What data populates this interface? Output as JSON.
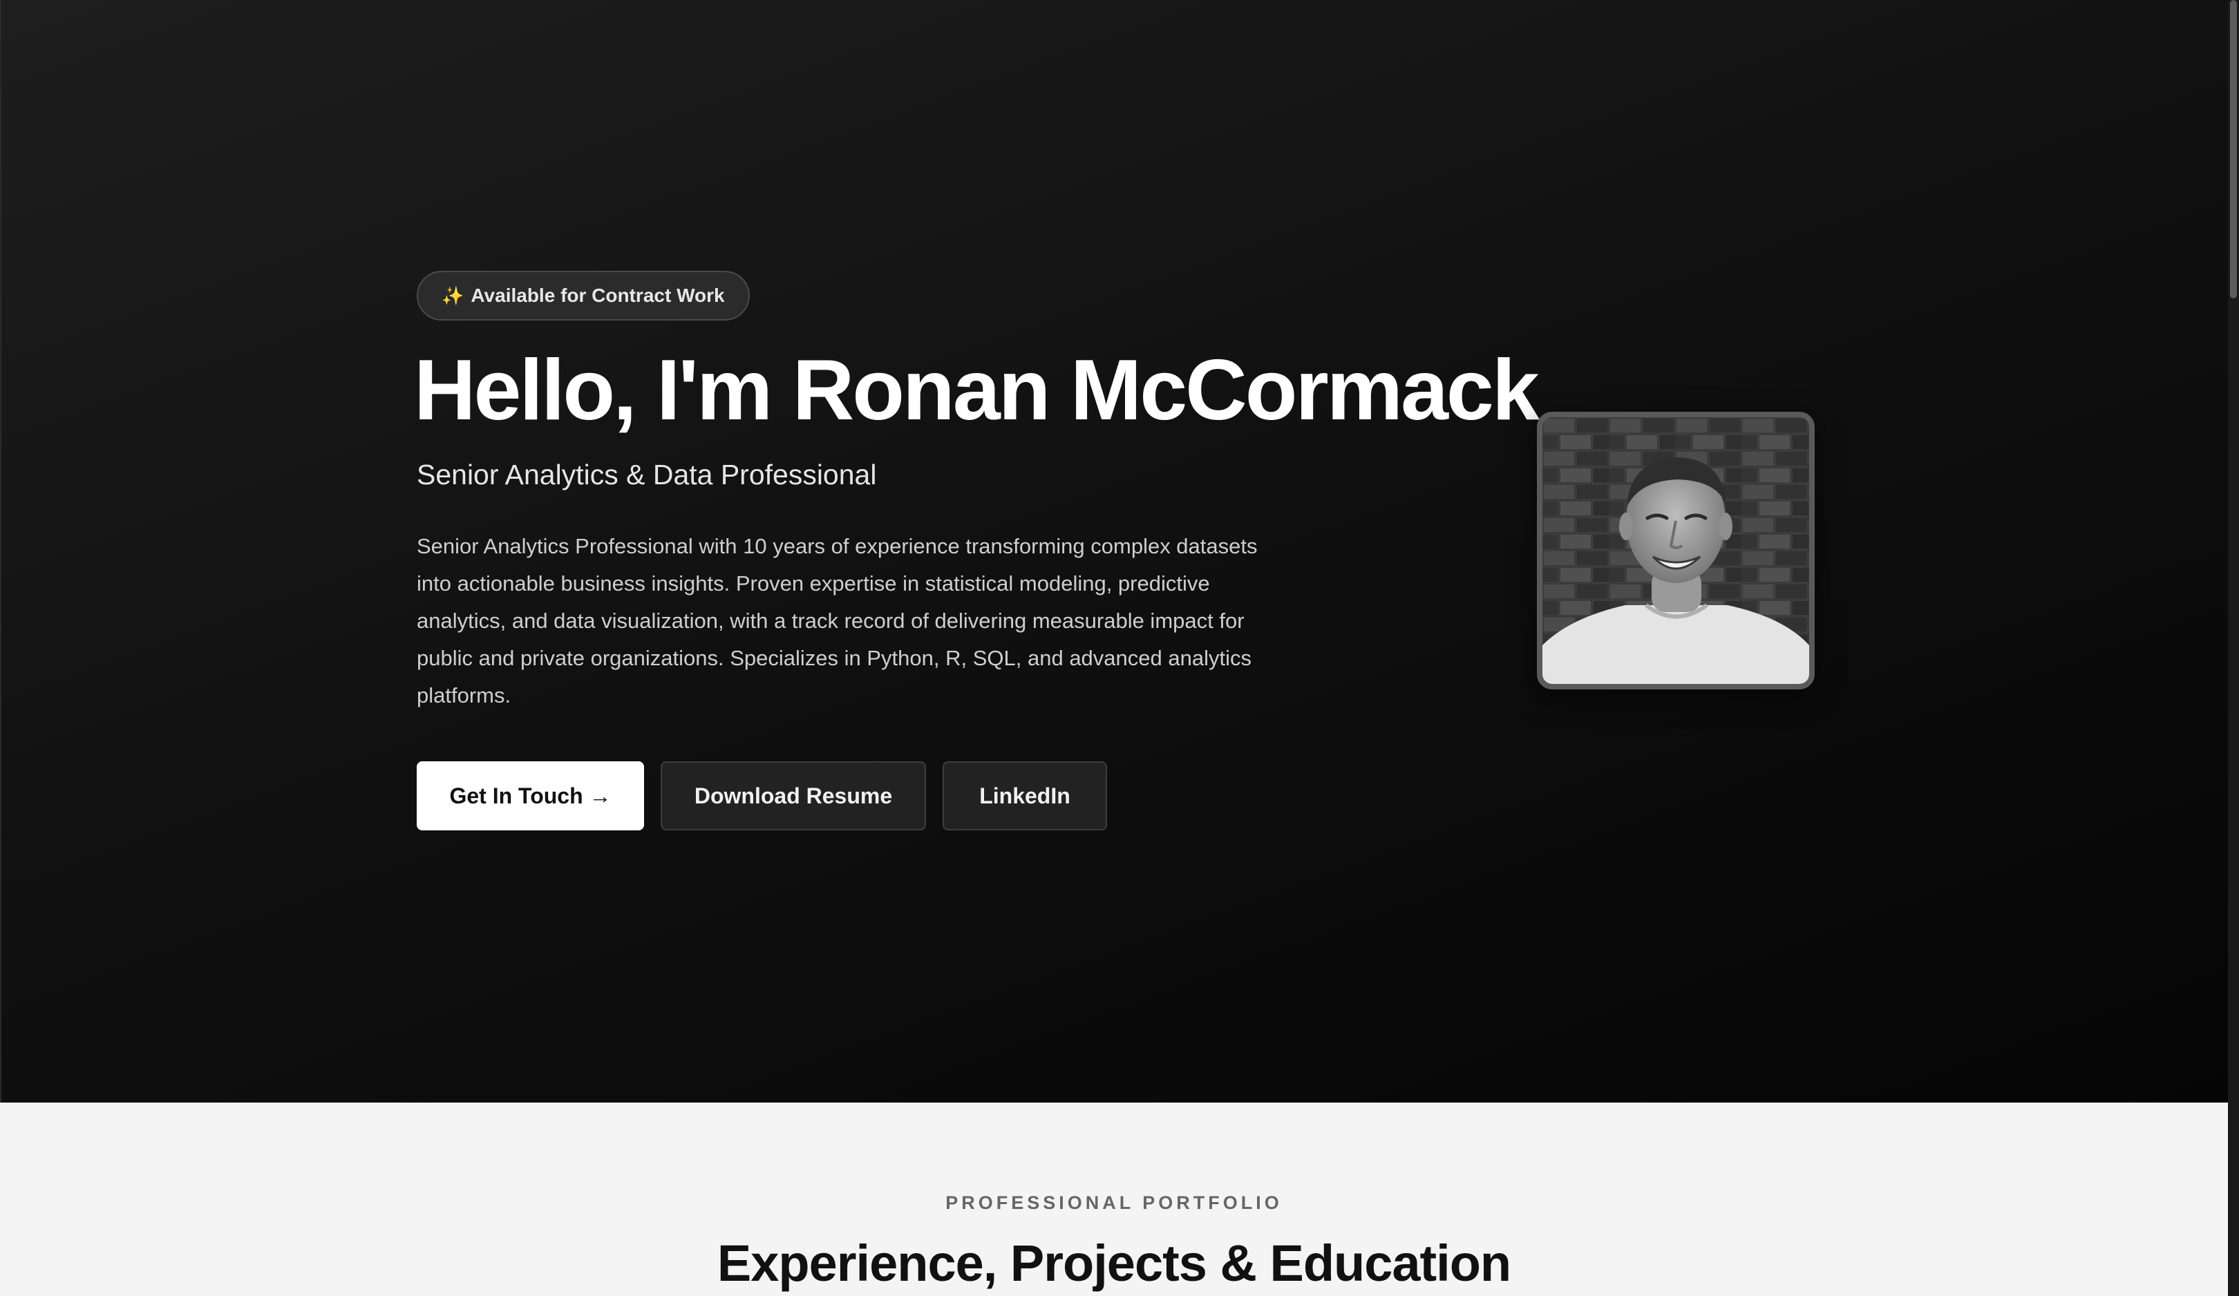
{
  "hero": {
    "badge": {
      "icon": "sparkle-icon",
      "icon_glyph": "✨",
      "label": "Available for Contract Work"
    },
    "title": "Hello, I'm Ronan McCormack",
    "subtitle": "Senior Analytics & Data Professional",
    "description": "Senior Analytics Professional with 10 years of experience transforming complex datasets into actionable business insights. Proven expertise in statistical modeling, predictive analytics, and data visualization, with a track record of delivering measurable impact for public and private organizations. Specializes in Python, R, SQL, and advanced analytics platforms.",
    "buttons": {
      "get_in_touch": "Get In Touch →",
      "download_resume": "Download Resume",
      "linkedin": "LinkedIn"
    }
  },
  "portfolio": {
    "eyebrow": "PROFESSIONAL PORTFOLIO",
    "title": "Experience, Projects & Education"
  },
  "colors": {
    "hero_background": "#111111",
    "primary_button": "#ffffff",
    "secondary_button": "#222222",
    "section_background": "#f4f4f4"
  }
}
